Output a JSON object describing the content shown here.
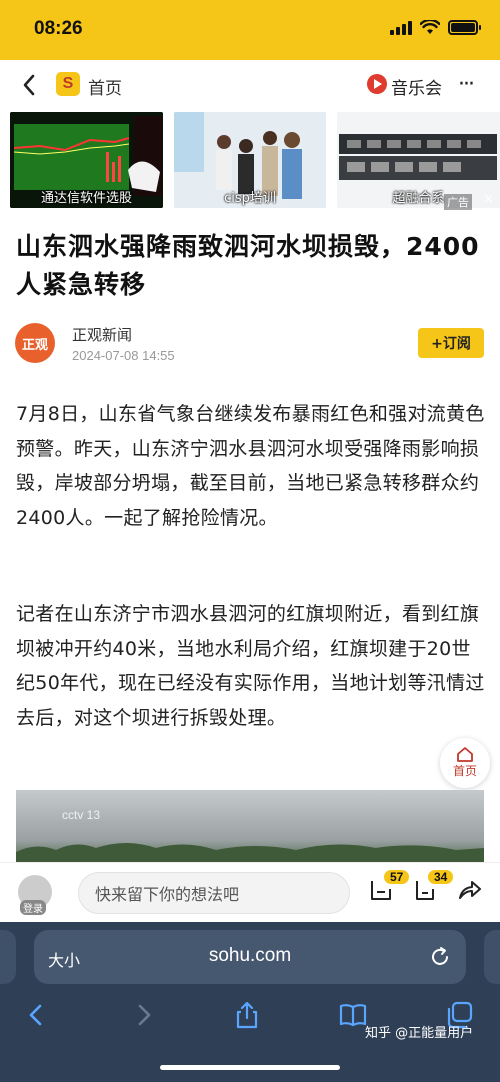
{
  "status": {
    "time": "08:26"
  },
  "nav": {
    "home_label": "首页",
    "logo_letter": "S",
    "music_label": "音乐会",
    "more_label": "···"
  },
  "ads": [
    {
      "caption": "通达信软件选股"
    },
    {
      "caption": "cisp培训"
    },
    {
      "caption": "超融合系"
    }
  ],
  "ad_badge": "广告",
  "ad_close": "×",
  "article": {
    "title": "山东泗水强降雨致泗河水坝损毁，2400人紧急转移",
    "author": "正观新闻",
    "author_avatar_text": "正观",
    "timestamp": "2024-07-08 14:55",
    "follow_label": "+订阅",
    "paragraphs": [
      "7月8日，山东省气象台继续发布暴雨红色和强对流黄色预警。昨天，山东济宁泗水县泗河水坝受强降雨影响损毁，岸坡部分坍塌，截至目前，当地已紧急转移群众约2400人。一起了解抢险情况。",
      "记者在山东济宁市泗水县泗河的红旗坝附近，看到红旗坝被冲开约40米，当地水利局介绍，红旗坝建于20世纪50年代，现在已经没有实际作用，当地计划等汛情过去后，对这个坝进行拆毁处理。"
    ],
    "video_logo": "cctv 13"
  },
  "float_home_label": "首页",
  "comment": {
    "login_label": "登录",
    "placeholder": "快来留下你的想法吧",
    "comment_count": "57",
    "like_count": "34"
  },
  "safari": {
    "aa_label": "大小",
    "url": "sohu.com",
    "watermark": "知乎 @正能量用户"
  },
  "colors": {
    "accent": "#f5c518",
    "safari_bg": "#2f3f56"
  }
}
